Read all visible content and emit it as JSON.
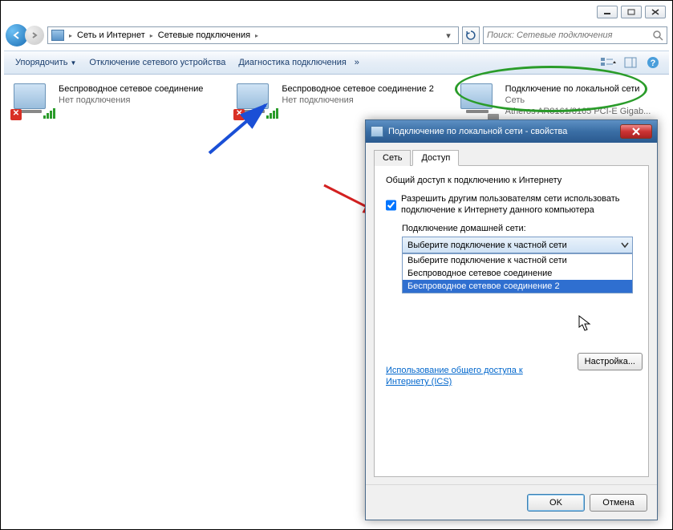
{
  "breadcrumb": {
    "root": "Сеть и Интернет",
    "leaf": "Сетевые подключения"
  },
  "search": {
    "placeholder": "Поиск: Сетевые подключения"
  },
  "toolbar": {
    "organize": "Упорядочить",
    "disable": "Отключение сетевого устройства",
    "diagnose": "Диагностика подключения",
    "more": "»"
  },
  "connections": [
    {
      "name": "Беспроводное сетевое соединение",
      "status": "Нет подключения"
    },
    {
      "name": "Беспроводное сетевое соединение 2",
      "status": "Нет подключения"
    },
    {
      "name": "Подключение по локальной сети",
      "sub1": "Сеть",
      "sub2": "Atheros AR8161/8165 PCI-E Gigab..."
    }
  ],
  "dialog": {
    "title": "Подключение по локальной сети - свойства",
    "tabs": {
      "net": "Сеть",
      "share": "Доступ"
    },
    "group": "Общий доступ к подключению к Интернету",
    "chk1": "Разрешить другим пользователям сети использовать подключение к Интернету данного компьютера",
    "homenet_label": "Подключение домашней сети:",
    "combo_value": "Выберите подключение к частной сети",
    "combo_items": [
      "Выберите подключение к частной сети",
      "Беспроводное сетевое соединение",
      "Беспроводное сетевое соединение 2"
    ],
    "link": "Использование общего доступа к Интернету (ICS)",
    "settings_btn": "Настройка...",
    "ok": "OK",
    "cancel": "Отмена"
  }
}
